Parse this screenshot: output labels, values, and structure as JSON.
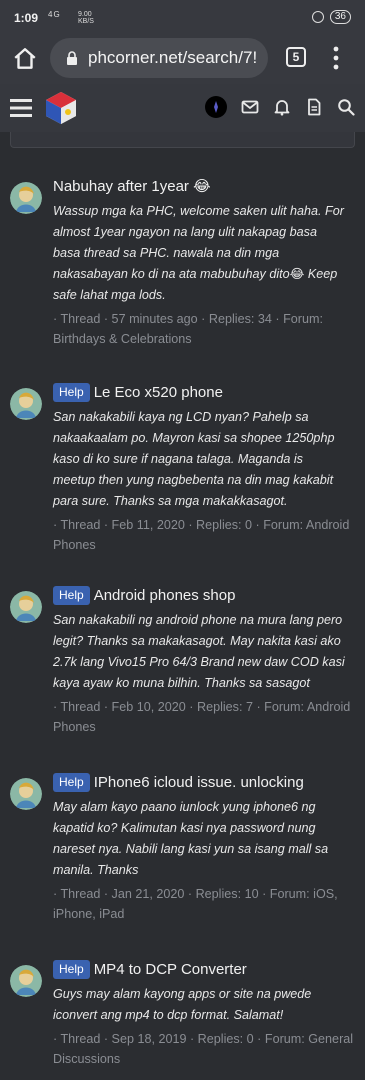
{
  "status": {
    "time": "1:09",
    "net": "4G",
    "speed_top": "9.00",
    "speed_bottom": "KB/S",
    "battery": "36"
  },
  "browser": {
    "url": "phcorner.net/search/7!",
    "tab_count": "5"
  },
  "results": [
    {
      "prefix": "",
      "title": "Nabuhay after 1year 😂",
      "snippet": "Wassup mga ka PHC, welcome saken ulit haha. For\nalmost 1year ngayon na lang ulit nakapag basa\nbasa thread sa PHC. nawala na din mga\nnakasabayan ko di na ata mabubuhay dito😂 Keep\nsafe lahat mga lods.",
      "meta": "· Thread · 57 minutes ago · Replies: 34 · Forum:\nBirthdays & Celebrations"
    },
    {
      "prefix": "Help",
      "title": "Le Eco x520 phone",
      "snippet": "San nakakabili kaya ng LCD nyan? Pahelp sa\nnakaakaalam po. Mayron kasi sa shopee 1250php\nkaso di ko sure if nagana talaga. Maganda is\nmeetup then yung nagbebenta na din mag kakabit\npara sure. Thanks sa mga makakkasagot.",
      "meta": "· Thread · Feb 11, 2020 · Replies: 0 · Forum: Android\nPhones"
    },
    {
      "prefix": "Help",
      "title": "Android phones shop",
      "snippet": "San nakakabili ng android phone na mura lang pero\nlegit? Thanks sa makakasagot. May nakita kasi ako\n2.7k lang Vivo15 Pro 64/3 Brand new daw COD kasi\nkaya ayaw ko muna bilhin. Thanks sa sasagot",
      "meta": "· Thread · Feb 10, 2020 · Replies: 7 · Forum: Android\nPhones"
    },
    {
      "prefix": "Help",
      "title": "IPhone6 icloud issue. unlocking",
      "snippet": "May alam kayo paano iunlock yung iphone6 ng\nkapatid ko? Kalimutan kasi nya password nung\nnareset nya. Nabili lang kasi yun sa isang mall sa\nmanila. Thanks",
      "meta": "· Thread · Jan 21, 2020 · Replies: 10 · Forum: iOS,\niPhone, iPad"
    },
    {
      "prefix": "Help",
      "title": "MP4 to DCP Converter",
      "snippet": "Guys may alam kayong apps or site na pwede\niconvert ang mp4 to dcp format. Salamat!",
      "meta": "· Thread · Sep 18, 2019 · Replies: 0 · Forum: General\nDiscussions"
    }
  ]
}
